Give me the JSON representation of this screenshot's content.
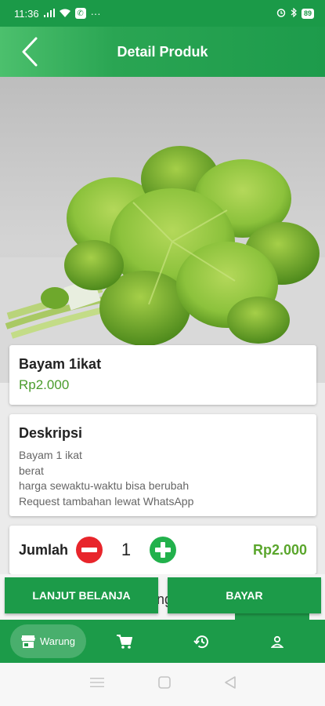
{
  "status_bar": {
    "time": "11:36",
    "signal_icon": "signal-icon",
    "wifi_icon": "wifi-icon",
    "whatsapp_icon": "whatsapp-icon",
    "more": "···",
    "battery": "89"
  },
  "header": {
    "title": "Detail Produk",
    "back_icon": "chevron-left-icon"
  },
  "product": {
    "name": "Bayam 1ikat",
    "price": "Rp2.000"
  },
  "description": {
    "title": "Deskripsi",
    "lines": [
      "Bayam 1 ikat",
      "berat",
      "harga sewaktu-waktu bisa berubah",
      "Request tambahan lewat WhatsApp"
    ]
  },
  "quantity": {
    "label": "Jumlah",
    "value": "1",
    "total": "Rp2.000"
  },
  "under_content": {
    "partial_text": "ng"
  },
  "actions": {
    "continue_label": "LANJUT BELANJA",
    "pay_label": "BAYAR"
  },
  "bottom_nav": {
    "items": [
      {
        "label": "Warung",
        "icon": "store-icon",
        "active": true
      },
      {
        "label": "",
        "icon": "cart-icon",
        "active": false
      },
      {
        "label": "",
        "icon": "history-icon",
        "active": false
      },
      {
        "label": "",
        "icon": "profile-icon",
        "active": false
      }
    ]
  },
  "colors": {
    "primary_green": "#1c9b49",
    "price_green": "#4a9c2c",
    "minus_red": "#e8252b",
    "plus_green": "#22b14c"
  }
}
